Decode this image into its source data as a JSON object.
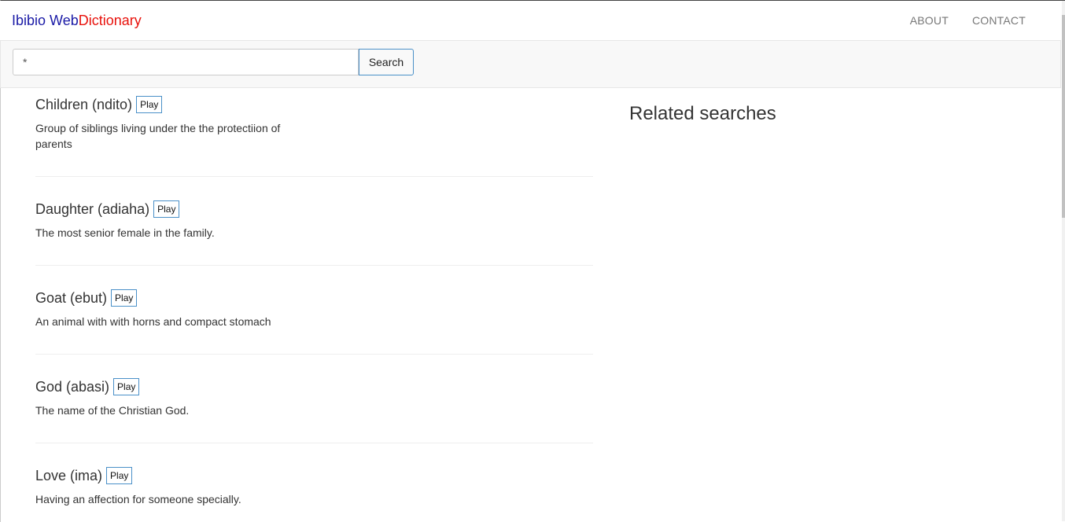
{
  "brand": {
    "part1": "Ibibio Web",
    "part2": "Dictionary"
  },
  "nav": {
    "about": "ABOUT",
    "contact": "CONTACT"
  },
  "search": {
    "value": "*",
    "button_label": "Search"
  },
  "entries": [
    {
      "word": "Children (ndito)",
      "play_label": "Play",
      "definition": "Group of siblings living under the the protectiion of parents"
    },
    {
      "word": "Daughter (adiaha)",
      "play_label": "Play",
      "definition": "The most senior female in the family."
    },
    {
      "word": "Goat (ebut)",
      "play_label": "Play",
      "definition": "An animal with with horns and compact stomach"
    },
    {
      "word": "God (abasi)",
      "play_label": "Play",
      "definition": "The name of the Christian God."
    },
    {
      "word": "Love (ima)",
      "play_label": "Play",
      "definition": "Having an affection for someone specially."
    }
  ],
  "related": {
    "title": "Related searches"
  },
  "colors": {
    "brand_blue": "#1a1aa6",
    "brand_red": "#e8120c",
    "button_border": "#4a90c8"
  }
}
